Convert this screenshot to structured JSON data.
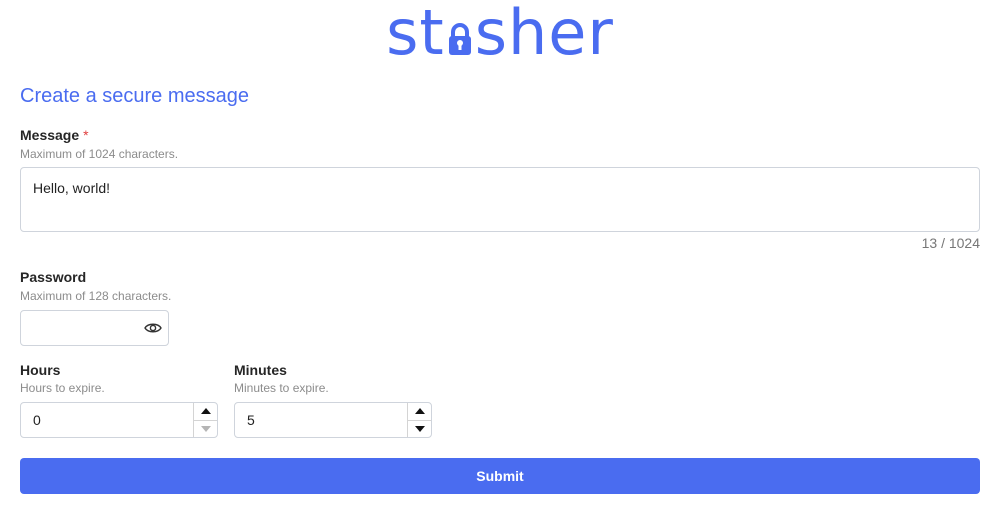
{
  "logo": {
    "part1": "st",
    "part2": "sher"
  },
  "page": {
    "heading": "Create a secure message"
  },
  "message": {
    "label": "Message",
    "required_mark": "*",
    "hint": "Maximum of 1024 characters.",
    "value": "Hello, world!",
    "counter": "13 / 1024"
  },
  "password": {
    "label": "Password",
    "hint": "Maximum of 128 characters.",
    "value": "",
    "toggle_icon": "eye-icon"
  },
  "hours": {
    "label": "Hours",
    "hint": "Hours to expire.",
    "value": "0"
  },
  "minutes": {
    "label": "Minutes",
    "hint": "Minutes to expire.",
    "value": "5"
  },
  "submit": {
    "label": "Submit"
  },
  "colors": {
    "accent": "#4a6cf0",
    "required": "#e03e3e"
  }
}
